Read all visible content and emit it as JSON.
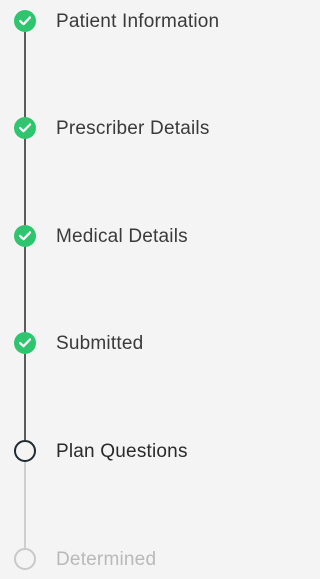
{
  "steps": [
    {
      "label": "Patient Information",
      "status": "complete",
      "icon": "check-icon"
    },
    {
      "label": "Prescriber Details",
      "status": "complete",
      "icon": "check-icon"
    },
    {
      "label": "Medical Details",
      "status": "complete",
      "icon": "check-icon"
    },
    {
      "label": "Submitted",
      "status": "complete",
      "icon": "check-icon"
    },
    {
      "label": "Plan Questions",
      "status": "current",
      "icon": "empty-circle-icon"
    },
    {
      "label": "Determined",
      "status": "upcoming",
      "icon": "empty-circle-icon"
    }
  ],
  "colors": {
    "complete": "#2fc56f",
    "connector_done": "#5b5b5b",
    "connector_pending": "#cfcfcf",
    "current_ring": "#1f2a33",
    "upcoming_ring": "#c9c9c9",
    "upcoming_text": "#b9b9b9"
  }
}
